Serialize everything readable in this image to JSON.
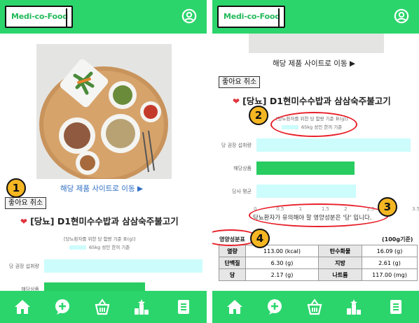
{
  "app": {
    "logo_text": "Medi-co-Food"
  },
  "colors": {
    "brand_green": "#2bd56c",
    "bar_recommended": "#ccfcfc",
    "bar_product": "#28cc60",
    "badge": "#f4b622",
    "highlight_ring": "#e8202a",
    "heart": "#e0333c"
  },
  "nav": {
    "items": [
      "home-icon",
      "chat-plus-icon",
      "basket-icon",
      "ranking-icon",
      "notebook-icon"
    ]
  },
  "product": {
    "link_text": "해당 제품 사이트로 이동 ▶",
    "like_button": "좋아요 취소",
    "title": "[당뇨] D1현미수수밥과 삼삼숙주불고기",
    "heart": "❤"
  },
  "chart_data": {
    "type": "bar",
    "orientation": "horizontal",
    "title": "[당뇨환자를 위한 당 함량 기준 표(g)]",
    "legend": [
      "65kg 성인 한끼 기준"
    ],
    "categories": [
      "당 권장 섭취량",
      "해당상품",
      "당사 평균"
    ],
    "values": [
      3.4,
      2.17,
      2.2
    ],
    "xlim": [
      0,
      3.5
    ],
    "xticks": [
      "0",
      "0.5",
      "1",
      "1.5",
      "2",
      "2.5",
      "3",
      "3.5"
    ],
    "bar_colors": [
      "#ccfcfc",
      "#28cc60",
      "#ccfcfc"
    ]
  },
  "tip": {
    "text": "당뇨환자가 유의해야 할 영양성분은 '당' 입니다."
  },
  "nutrition": {
    "label": "영양성분표",
    "unit": "(100g기준)",
    "rows": [
      {
        "k1": "열량",
        "v1": "113.00 (kcal)",
        "k2": "탄수화물",
        "v2": "16.09 (g)"
      },
      {
        "k1": "단백질",
        "v1": "6.30 (g)",
        "k2": "지방",
        "v2": "2.61 (g)"
      },
      {
        "k1": "당",
        "v1": "2.17 (g)",
        "k2": "나트륨",
        "v2": "117.00 (mg)"
      }
    ]
  },
  "badges": [
    "1",
    "2",
    "3",
    "4"
  ]
}
